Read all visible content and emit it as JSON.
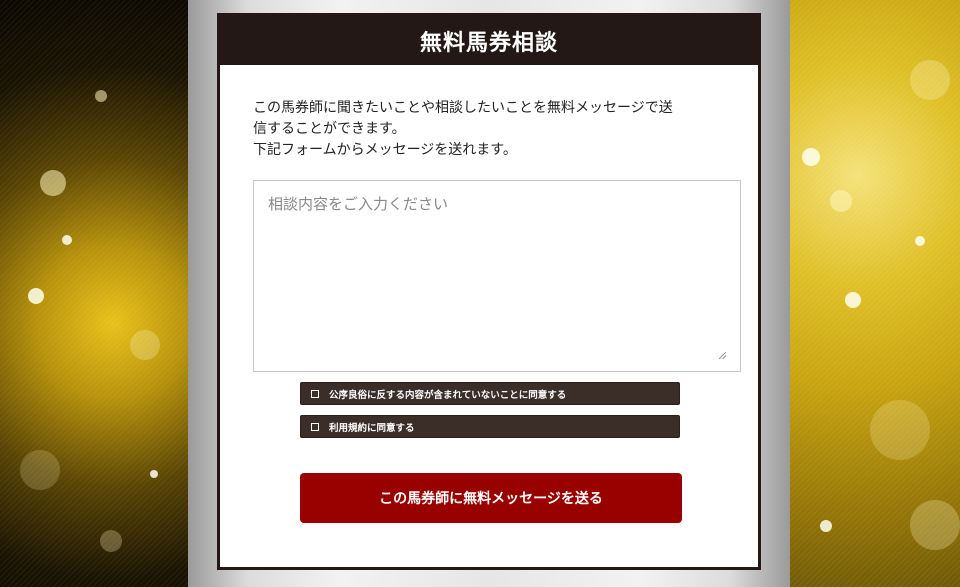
{
  "card": {
    "title": "無料馬券相談",
    "intro_lines": [
      "この馬券師に聞きたいことや相談したいことを無料メッセージで送",
      "信することができます。",
      "下記フォームからメッセージを送れます。"
    ]
  },
  "form": {
    "message_placeholder": "相談内容をご入力ください",
    "message_value": "",
    "checkboxes": [
      {
        "label": "公序良俗に反する内容が含まれていないことに同意する",
        "checked": false
      },
      {
        "label": "利用規約に同意する",
        "checked": false
      }
    ],
    "submit_label": "この馬券師に無料メッセージを送る"
  },
  "colors": {
    "header_bg": "#231815",
    "checkbox_bg": "#3b2e28",
    "submit_bg": "#990000",
    "background_gold": "#c8a410"
  }
}
